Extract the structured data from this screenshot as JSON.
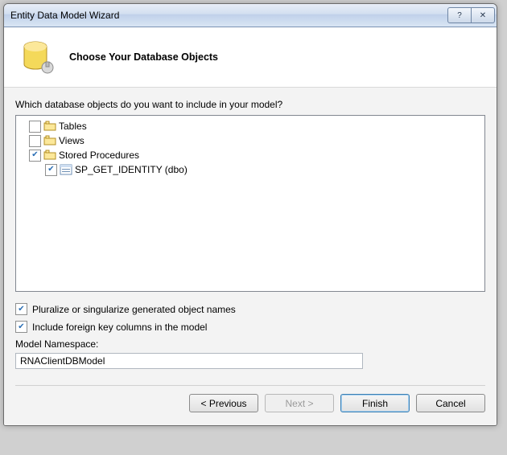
{
  "window": {
    "title": "Entity Data Model Wizard"
  },
  "header": {
    "title": "Choose Your Database Objects"
  },
  "prompt": "Which database objects do you want to include in your model?",
  "tree": {
    "items": [
      {
        "label": "Tables",
        "checked": false,
        "indent": 0,
        "icon": "folder"
      },
      {
        "label": "Views",
        "checked": false,
        "indent": 0,
        "icon": "folder"
      },
      {
        "label": "Stored Procedures",
        "checked": true,
        "indent": 0,
        "icon": "folder"
      },
      {
        "label": "SP_GET_IDENTITY (dbo)",
        "checked": true,
        "indent": 1,
        "icon": "proc"
      }
    ]
  },
  "options": {
    "pluralize": {
      "label": "Pluralize or singularize generated object names",
      "checked": true
    },
    "foreign_keys": {
      "label": "Include foreign key columns in the model",
      "checked": true
    }
  },
  "namespace": {
    "label": "Model Namespace:",
    "value": "RNAClientDBModel"
  },
  "buttons": {
    "previous": "< Previous",
    "next": "Next >",
    "finish": "Finish",
    "cancel": "Cancel"
  }
}
